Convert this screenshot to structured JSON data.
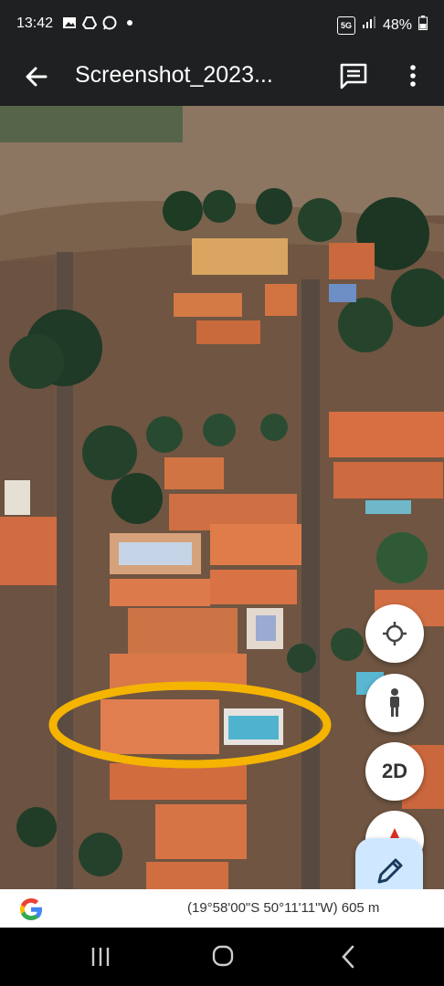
{
  "status": {
    "time": "13:42",
    "battery": "48%",
    "network": "5G",
    "left_icons": [
      "image-icon",
      "drive-icon",
      "whatsapp-icon",
      "dot-icon"
    ]
  },
  "app_bar": {
    "title": "Screenshot_2023...",
    "back_icon": "arrow-left-icon",
    "comment_icon": "comment-icon",
    "more_icon": "more-vertical-icon"
  },
  "map": {
    "controls": [
      "location-target-icon",
      "person-icon",
      "2D",
      "compass-icon"
    ],
    "twod_label": "2D",
    "highlight_color": "#f4b400"
  },
  "bottom": {
    "coords": "(19°58'00\"S 50°11'11\"W) 605 m"
  },
  "nav": {
    "buttons": [
      "recent-apps-icon",
      "home-icon",
      "back-icon"
    ]
  }
}
